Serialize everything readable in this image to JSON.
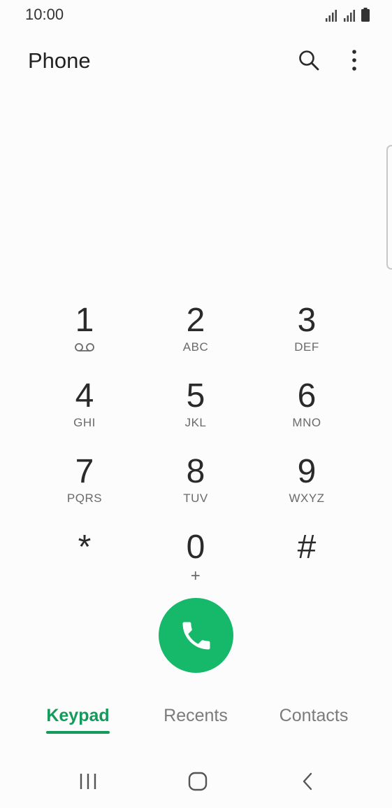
{
  "status": {
    "time": "10:00"
  },
  "app": {
    "title": "Phone"
  },
  "icons": {
    "search": "search-icon",
    "more": "more-vert-icon",
    "voicemail": "voicemail-icon",
    "call": "phone-icon"
  },
  "keypad": {
    "keys": [
      {
        "digit": "1",
        "letters": ""
      },
      {
        "digit": "2",
        "letters": "ABC"
      },
      {
        "digit": "3",
        "letters": "DEF"
      },
      {
        "digit": "4",
        "letters": "GHI"
      },
      {
        "digit": "5",
        "letters": "JKL"
      },
      {
        "digit": "6",
        "letters": "MNO"
      },
      {
        "digit": "7",
        "letters": "PQRS"
      },
      {
        "digit": "8",
        "letters": "TUV"
      },
      {
        "digit": "9",
        "letters": "WXYZ"
      },
      {
        "digit": "*",
        "letters": ""
      },
      {
        "digit": "0",
        "letters": "+"
      },
      {
        "digit": "#",
        "letters": ""
      }
    ]
  },
  "tabs": {
    "keypad": "Keypad",
    "recents": "Recents",
    "contacts": "Contacts",
    "active": "Keypad"
  },
  "colors": {
    "accent": "#149a5a",
    "call": "#16b86a",
    "background": "#fcfcfc"
  }
}
